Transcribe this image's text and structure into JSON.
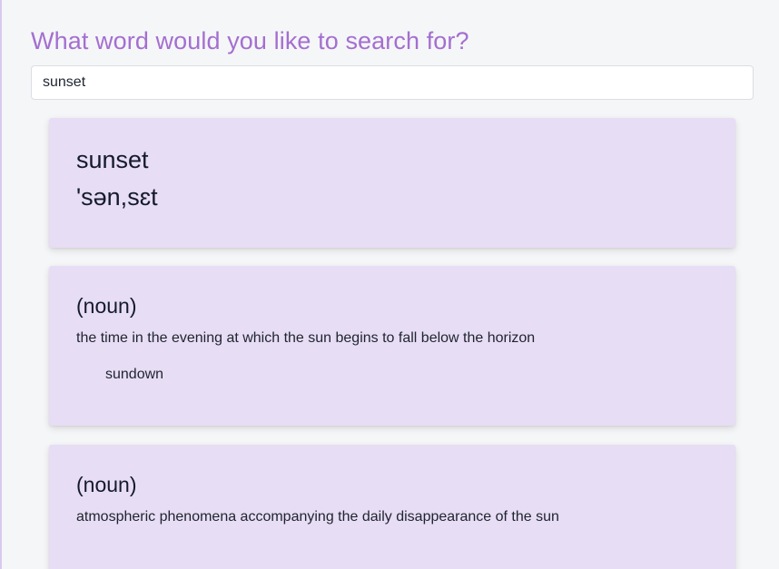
{
  "header": {
    "title": "What word would you like to search for?"
  },
  "search": {
    "value": "sunset",
    "placeholder": ""
  },
  "entry": {
    "word": "sunset",
    "phonetic": "'sən,sɛt"
  },
  "meanings": [
    {
      "part_of_speech": "(noun)",
      "definition": "the time in the evening at which the sun begins to fall below the horizon",
      "synonym": "sundown"
    },
    {
      "part_of_speech": "(noun)",
      "definition": "atmospheric phenomena accompanying the daily disappearance of the sun"
    }
  ],
  "colors": {
    "accent": "#a46fd0",
    "card_background": "#e7ddf4",
    "page_background": "#f5f6f8",
    "text": "#141a2c"
  }
}
